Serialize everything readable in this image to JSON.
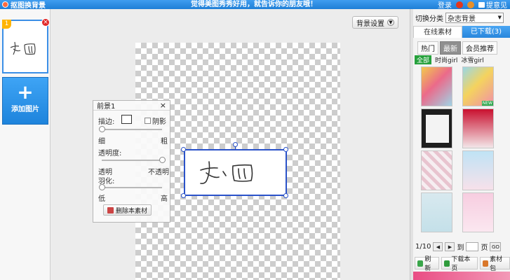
{
  "titlebar": {
    "app_title": "抠图换背景",
    "slogan": "觉得美图秀秀好用，就告诉你的朋友哦！",
    "login": "登录",
    "feedback": "提意见"
  },
  "leftpanel": {
    "thumb_number": "1",
    "add_label": "添加图片"
  },
  "workspace": {
    "bg_settings": "背景设置"
  },
  "foreground_panel": {
    "title": "前景1",
    "stroke_label": "描边:",
    "shadow_label": "阴影",
    "thin": "细",
    "thick": "粗",
    "opacity_label": "透明度:",
    "transparent": "透明",
    "opaque": "不透明",
    "feather_label": "羽化:",
    "low": "低",
    "high": "高",
    "delete_label": "删除本素材",
    "stroke_level": 0.0,
    "opacity_level": 1.0,
    "feather_level": 0.0
  },
  "rightpanel": {
    "category_label": "切换分类",
    "category_value": "杂志背景",
    "tab_online": "在线素材",
    "tab_downloaded": "已下载(3)",
    "subtabs": [
      "热门",
      "最新",
      "会员推荐"
    ],
    "filters": [
      "全部",
      "时尚girl",
      "冰雪girl"
    ],
    "new_badge": "NEW",
    "page_indicator": "1/10",
    "goto_label": "到",
    "page_unit": "页",
    "go": "GO",
    "refresh": "刷新",
    "download_page": "下载本页",
    "material_pack": "素材包"
  },
  "colors": {
    "accent": "#2886dc",
    "selection": "#2a52c9",
    "green": "#26a13c"
  }
}
